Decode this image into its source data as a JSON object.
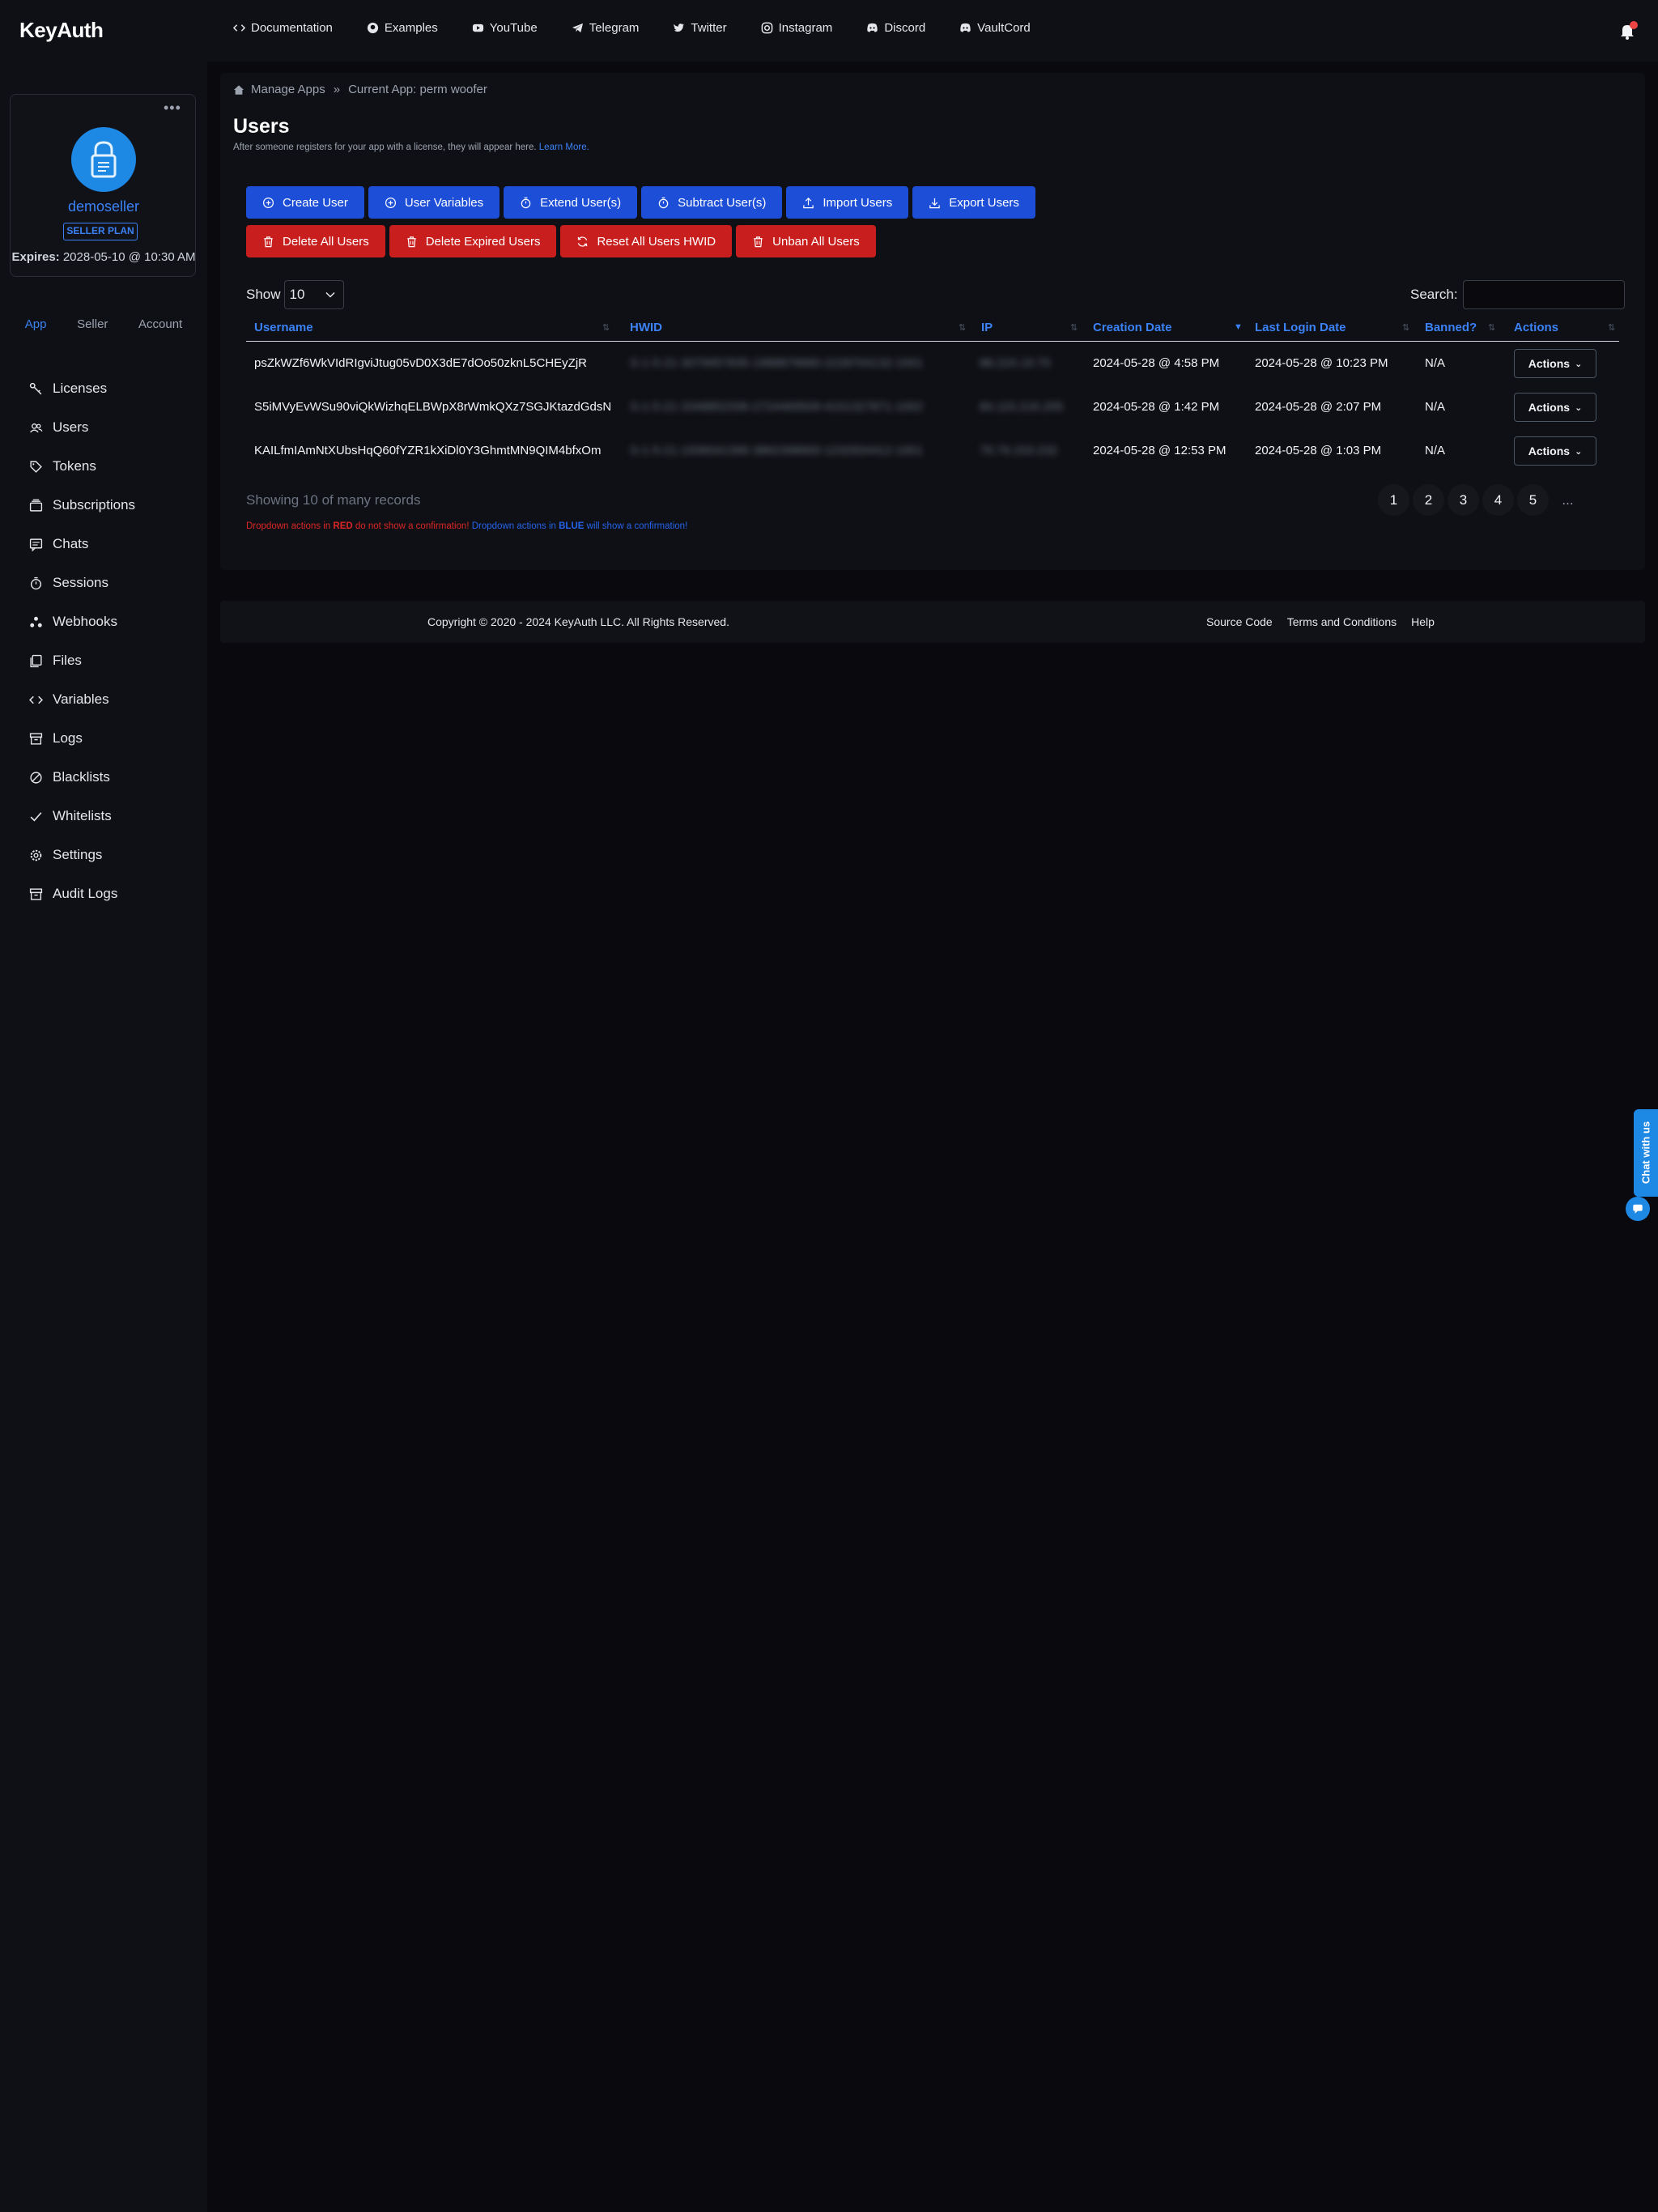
{
  "brand": "KeyAuth",
  "nav": [
    {
      "label": "Documentation",
      "icon": "code-icon"
    },
    {
      "label": "Examples",
      "icon": "github-icon"
    },
    {
      "label": "YouTube",
      "icon": "youtube-icon"
    },
    {
      "label": "Telegram",
      "icon": "telegram-icon"
    },
    {
      "label": "Twitter",
      "icon": "twitter-icon"
    },
    {
      "label": "Instagram",
      "icon": "instagram-icon"
    },
    {
      "label": "Discord",
      "icon": "discord-icon"
    },
    {
      "label": "VaultCord",
      "icon": "discord-icon"
    }
  ],
  "profile": {
    "name": "demoseller",
    "plan": "SELLER PLAN",
    "expires_label": "Expires:",
    "expires_value": "2028-05-10 @ 10:30 AM"
  },
  "side_tabs": [
    "App",
    "Seller",
    "Account"
  ],
  "side_menu": [
    {
      "label": "Licenses",
      "icon": "key-icon"
    },
    {
      "label": "Users",
      "icon": "users-icon"
    },
    {
      "label": "Tokens",
      "icon": "tag-icon"
    },
    {
      "label": "Subscriptions",
      "icon": "subscriptions-icon"
    },
    {
      "label": "Chats",
      "icon": "chat-icon"
    },
    {
      "label": "Sessions",
      "icon": "timer-icon"
    },
    {
      "label": "Webhooks",
      "icon": "webhook-icon"
    },
    {
      "label": "Files",
      "icon": "files-icon"
    },
    {
      "label": "Variables",
      "icon": "code-icon"
    },
    {
      "label": "Logs",
      "icon": "archive-icon"
    },
    {
      "label": "Blacklists",
      "icon": "ban-icon"
    },
    {
      "label": "Whitelists",
      "icon": "check-icon"
    },
    {
      "label": "Settings",
      "icon": "gear-icon"
    },
    {
      "label": "Audit Logs",
      "icon": "archive-icon"
    }
  ],
  "breadcrumb": {
    "home": "Manage Apps",
    "current": "Current App: perm woofer"
  },
  "page": {
    "title": "Users",
    "subtitle": "After someone registers for your app with a license, they will appear here.",
    "learn_more": "Learn More."
  },
  "buttons_blue": [
    "Create User",
    "User Variables",
    "Extend User(s)",
    "Subtract User(s)",
    "Import Users",
    "Export Users"
  ],
  "buttons_red": [
    "Delete All Users",
    "Delete Expired Users",
    "Reset All Users HWID",
    "Unban All Users"
  ],
  "table": {
    "show_label": "Show",
    "show_value": "10",
    "search_label": "Search:",
    "columns": [
      "Username",
      "HWID",
      "IP",
      "Creation Date",
      "Last Login Date",
      "Banned?",
      "Actions"
    ],
    "rows": [
      {
        "username": "psZkWZf6WkVIdRIgviJtug05vD0X3dE7dOo50zknL5CHEyZjR",
        "hwid": "S-1-5-21-3079957835-1988879680-2228704132-1001",
        "ip": "88.224.19.70",
        "created": "2024-05-28 @ 4:58 PM",
        "last_login": "2024-05-28 @ 10:23 PM",
        "banned": "N/A",
        "action": "Actions"
      },
      {
        "username": "S5iMVyEvWSu90viQkWizhqELBWpX8rWmkQXz7SGJKtazdGdsN",
        "hwid": "S-1-5-21-3348852336-2724469509-4151327871-1002",
        "ip": "84.115.216.205",
        "created": "2024-05-28 @ 1:42 PM",
        "last_login": "2024-05-28 @ 2:07 PM",
        "banned": "N/A",
        "action": "Actions"
      },
      {
        "username": "KAILfmIAmNtXUbsHqQ60fYZR1kXiDl0Y3GhmtMN9QIM4bfxOm",
        "hwid": "S-1-5-21-1936041396-3862398900-1232504412-1001",
        "ip": "79.79.153.232",
        "created": "2024-05-28 @ 12:53 PM",
        "last_login": "2024-05-28 @ 1:03 PM",
        "banned": "N/A",
        "action": "Actions"
      }
    ],
    "showing": "Showing 10 of many records",
    "pages": [
      "1",
      "2",
      "3",
      "4",
      "5",
      "..."
    ]
  },
  "legend": {
    "red_a": "Dropdown actions in ",
    "red_b": "RED",
    "red_c": " do not show a confirmation! ",
    "blue_a": "Dropdown actions in ",
    "blue_b": "BLUE",
    "blue_c": " will show a confirmation!"
  },
  "footer": {
    "copyright": "Copyright © 2020 - 2024 KeyAuth LLC. All Rights Reserved.",
    "links": [
      "Source Code",
      "Terms and Conditions",
      "Help"
    ]
  },
  "chat_widget": "Chat with us"
}
